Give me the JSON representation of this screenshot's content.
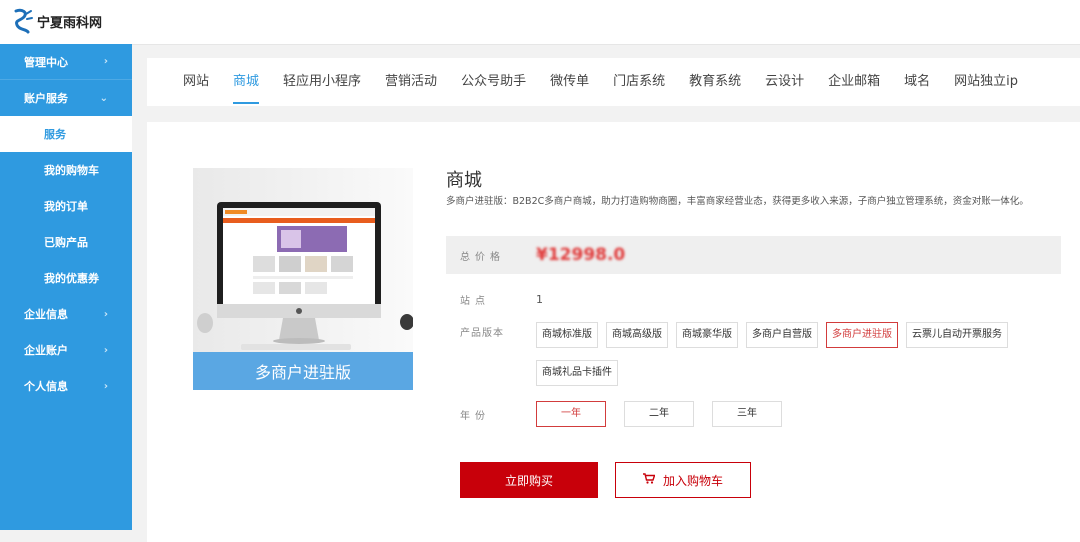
{
  "brand": {
    "name": "宁夏雨科网"
  },
  "sidebar": {
    "items": [
      {
        "label": "管理中心",
        "icon": "chevron-right-icon"
      },
      {
        "label": "账户服务",
        "icon": "chevron-down-icon"
      },
      {
        "label": "企业信息",
        "icon": "chevron-right-icon"
      },
      {
        "label": "企业账户",
        "icon": "chevron-right-icon"
      },
      {
        "label": "个人信息",
        "icon": "chevron-right-icon"
      }
    ],
    "account_sub": [
      "服务",
      "我的购物车",
      "我的订单",
      "已购产品",
      "我的优惠券"
    ],
    "active_sub": "服务",
    "chevron_right": "›",
    "chevron_down": "⌄"
  },
  "tabs": [
    "网站",
    "商城",
    "轻应用小程序",
    "营销活动",
    "公众号助手",
    "微传单",
    "门店系统",
    "教育系统",
    "云设计",
    "企业邮箱",
    "域名",
    "网站独立ip"
  ],
  "active_tab": "商城",
  "product": {
    "caption": "多商户进驻版",
    "title": "商城",
    "description": "多商户进驻版：B2B2C多商户商城，助力打造购物商圈，丰富商家经营业态，获得更多收入来源，子商户独立管理系统，资金对账一体化。",
    "price_label": "总价格",
    "price": "¥12998.0",
    "site_label": "站点",
    "site_value": "1",
    "version_label": "产品版本",
    "versions": [
      "商城标准版",
      "商城高级版",
      "商城豪华版",
      "多商户自营版",
      "多商户进驻版",
      "云票儿自动开票服务",
      "商城礼品卡插件"
    ],
    "selected_version": "多商户进驻版",
    "year_label": "年份",
    "years": [
      "一年",
      "二年",
      "三年"
    ],
    "selected_year": "一年"
  },
  "actions": {
    "buy": "立即购买",
    "cart": "加入购物车",
    "cart_icon": "cart-icon"
  },
  "colors": {
    "sidebar": "#2f9ae0",
    "accent": "#2f9ae0",
    "price": "#e03c3c",
    "buy": "#c8000a"
  }
}
